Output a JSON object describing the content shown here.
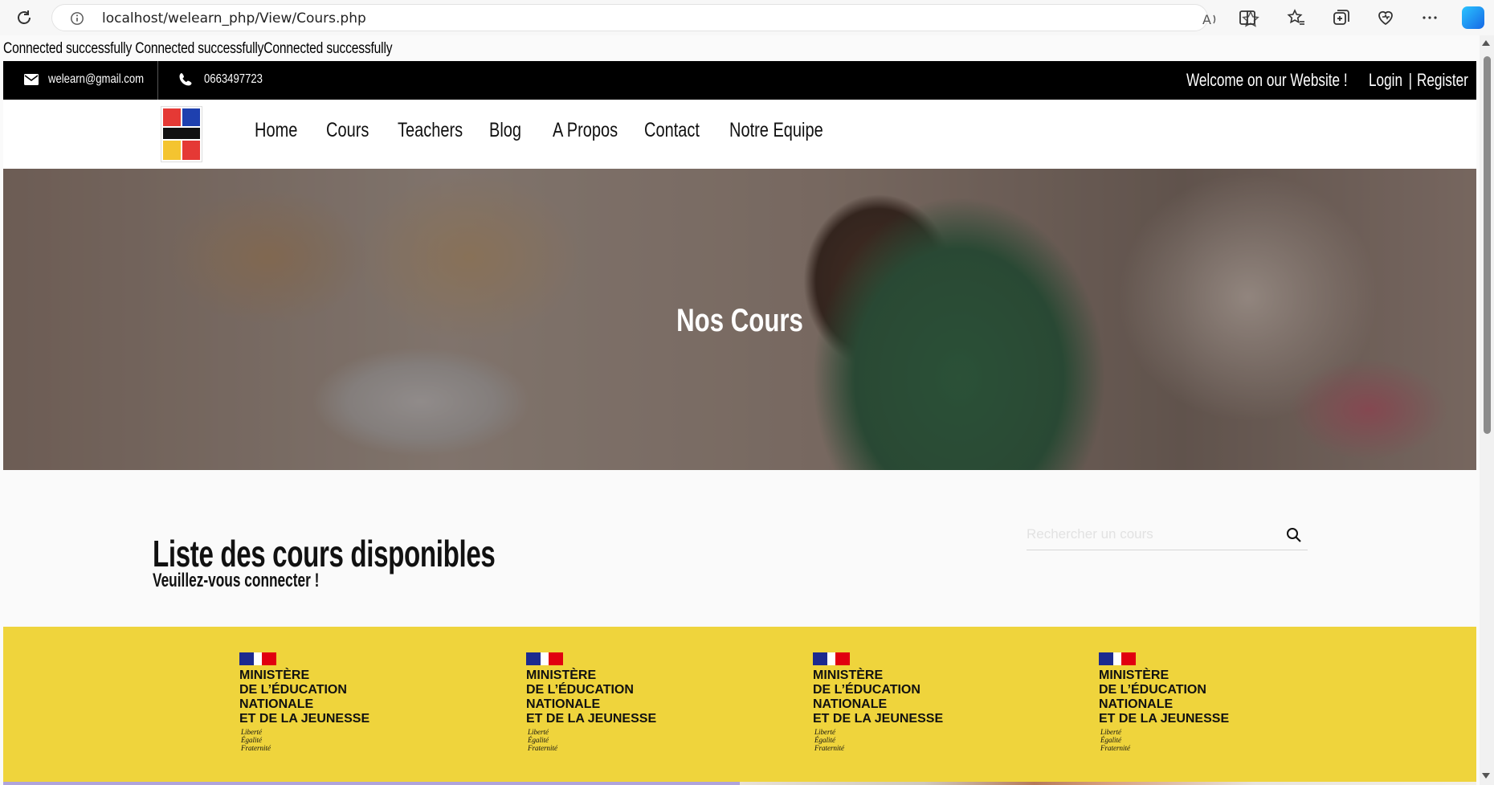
{
  "browser": {
    "url": "localhost/welearn_php/View/Cours.php"
  },
  "debug_text": "Connected successfully Connected successfullyConnected successfully",
  "topbar": {
    "email": "welearn@gmail.com",
    "phone": "0663497723",
    "welcome": "Welcome on our Website !",
    "login": "Login",
    "separator": "|",
    "register": "Register"
  },
  "nav": {
    "items": [
      "Home",
      "Cours",
      "Teachers",
      "Blog",
      "A Propos",
      "Contact",
      "Notre Equipe"
    ]
  },
  "hero": {
    "title": "Nos Cours"
  },
  "courses": {
    "title": "Liste des cours disponibles",
    "subtitle": "Veuillez-vous connecter !",
    "search_placeholder": "Rechercher un cours"
  },
  "ministry": {
    "text": "MINISTÈRE\nDE L’ÉDUCATION\nNATIONALE\nET DE LA JEUNESSE",
    "motto": "Liberté\nÉgalité\nFraternité"
  },
  "colors": {
    "topbar": "#000000",
    "band": "#efd43c",
    "lavender": "#afa4dc"
  }
}
